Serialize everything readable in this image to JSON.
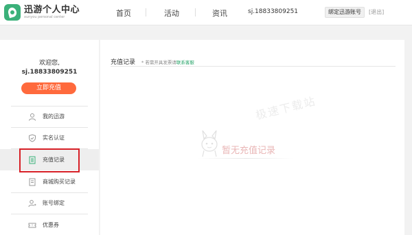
{
  "header": {
    "logo_title": "迅游个人中心",
    "logo_subtitle": "xunyou personal center",
    "nav": [
      {
        "label": "首页"
      },
      {
        "label": "活动"
      },
      {
        "label": "资讯"
      }
    ],
    "account": "sj.18833809251",
    "bind_button": "绑定迅游账号",
    "logout": "[退出]"
  },
  "sidebar": {
    "welcome": "欢迎您,",
    "account": "sj.18833809251",
    "recharge_button": "立即充值",
    "items": [
      {
        "label": "我的迅游",
        "icon": "user-icon"
      },
      {
        "label": "实名认证",
        "icon": "shield-check-icon"
      },
      {
        "label": "充值记录",
        "icon": "document-icon",
        "active": true
      },
      {
        "label": "商城购买记录",
        "icon": "receipt-icon"
      },
      {
        "label": "账号绑定",
        "icon": "user-link-icon"
      },
      {
        "label": "优惠券",
        "icon": "coupon-icon"
      }
    ]
  },
  "main": {
    "title": "充值记录",
    "hint_prefix": "* 若需开具发票请",
    "hint_link": "联系客服",
    "empty_text": "暂无充值记录",
    "watermark": "极速下载站"
  },
  "colors": {
    "brand_green": "#3bb17a",
    "recharge_orange": "#ff6a3d",
    "link_green": "#2aa56b",
    "highlight_red": "#d71f26",
    "empty_text": "#e9b6b6"
  }
}
